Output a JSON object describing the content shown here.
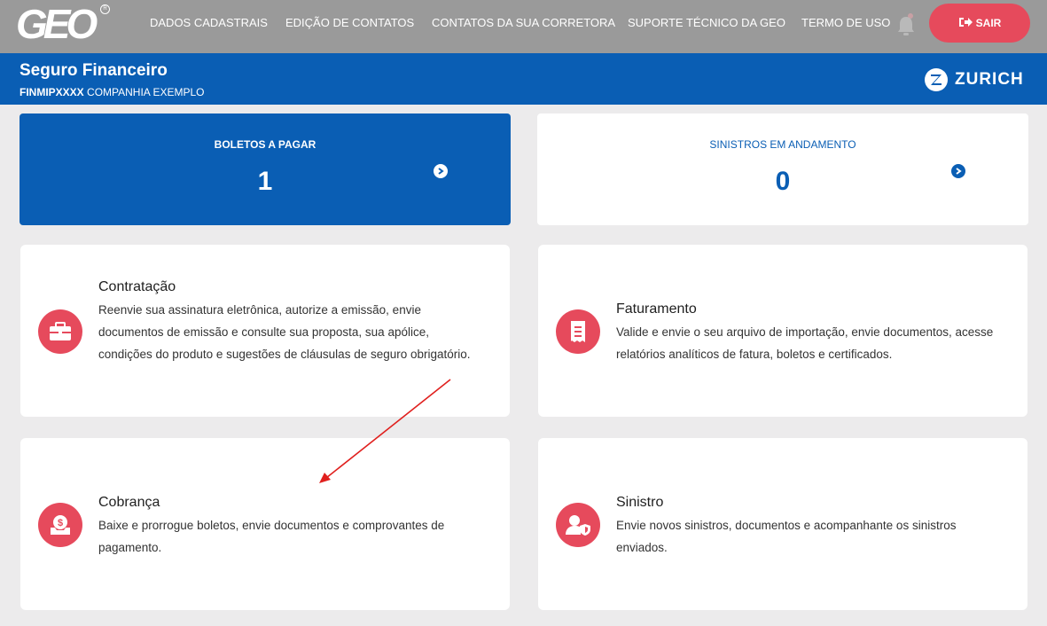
{
  "nav": {
    "logo": "GEO",
    "links": [
      "DADOS CADASTRAIS",
      "EDIÇÃO DE CONTATOS",
      "CONTATOS DA SUA CORRETORA",
      "SUPORTE TÉCNICO DA GEO",
      "TERMO DE USO"
    ],
    "logout_label": "SAIR",
    "bell_icon": "bell-icon",
    "logout_icon": "sign-out-icon"
  },
  "header": {
    "title": "Seguro Financeiro",
    "code": "FINMIPXXXX",
    "company": "COMPANHIA EXEMPLO",
    "insurer": "ZURICH"
  },
  "stats": {
    "boletos": {
      "label": "BOLETOS A PAGAR",
      "value": "1"
    },
    "sinistros": {
      "label": "SINISTROS EM ANDAMENTO",
      "value": "0"
    }
  },
  "cards": {
    "contratacao": {
      "title": "Contratação",
      "description": "Reenvie sua assinatura eletrônica, autorize a emissão, envie documentos de emissão e consulte sua proposta, sua apólice, condições do produto e sugestões de cláusulas de seguro obrigatório.",
      "icon": "briefcase-icon"
    },
    "faturamento": {
      "title": "Faturamento",
      "description": "Valide e envie o seu arquivo de importação, envie documentos, acesse relatórios analíticos de fatura, boletos e certificados.",
      "icon": "receipt-icon"
    },
    "cobranca": {
      "title": "Cobrança",
      "description": "Baixe e prorrogue boletos, envie documentos e comprovantes de pagamento.",
      "icon": "money-inbox-icon"
    },
    "sinistro": {
      "title": "Sinistro",
      "description": "Envie novos sinistros, documentos e acompanhante os sinistros enviados.",
      "icon": "user-shield-icon"
    }
  },
  "colors": {
    "nav_bg": "#9a9a9a",
    "brand_blue": "#0a5eb4",
    "accent_red": "#e64a5c",
    "page_bg": "#ecebec",
    "annotation_arrow": "#e0201e"
  }
}
